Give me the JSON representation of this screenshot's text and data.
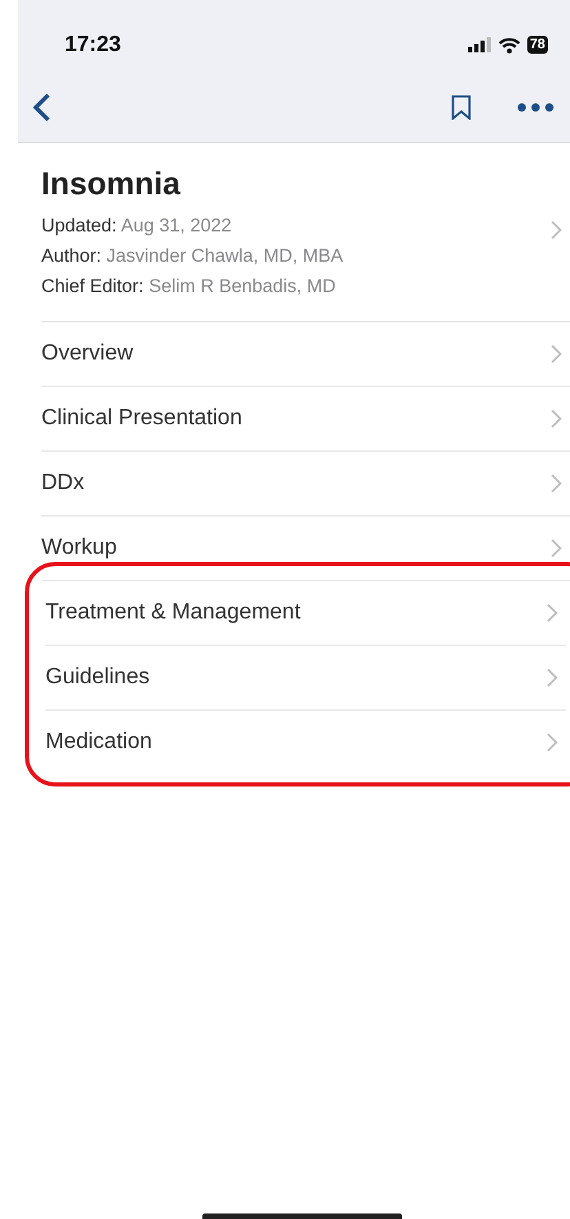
{
  "status_bar": {
    "time": "17:23",
    "battery": "78"
  },
  "article": {
    "title": "Insomnia",
    "meta": [
      {
        "label": "Updated:",
        "value": "Aug 31, 2022"
      },
      {
        "label": "Author:",
        "value": "Jasvinder Chawla, MD, MBA"
      },
      {
        "label": "Chief Editor:",
        "value": "Selim R Benbadis, MD"
      }
    ]
  },
  "sections": [
    {
      "label": "Overview",
      "highlighted": false
    },
    {
      "label": "Clinical Presentation",
      "highlighted": false
    },
    {
      "label": "DDx",
      "highlighted": false
    },
    {
      "label": "Workup",
      "highlighted": false
    },
    {
      "label": "Treatment & Management",
      "highlighted": true
    },
    {
      "label": "Guidelines",
      "highlighted": true
    },
    {
      "label": "Medication",
      "highlighted": true
    }
  ]
}
